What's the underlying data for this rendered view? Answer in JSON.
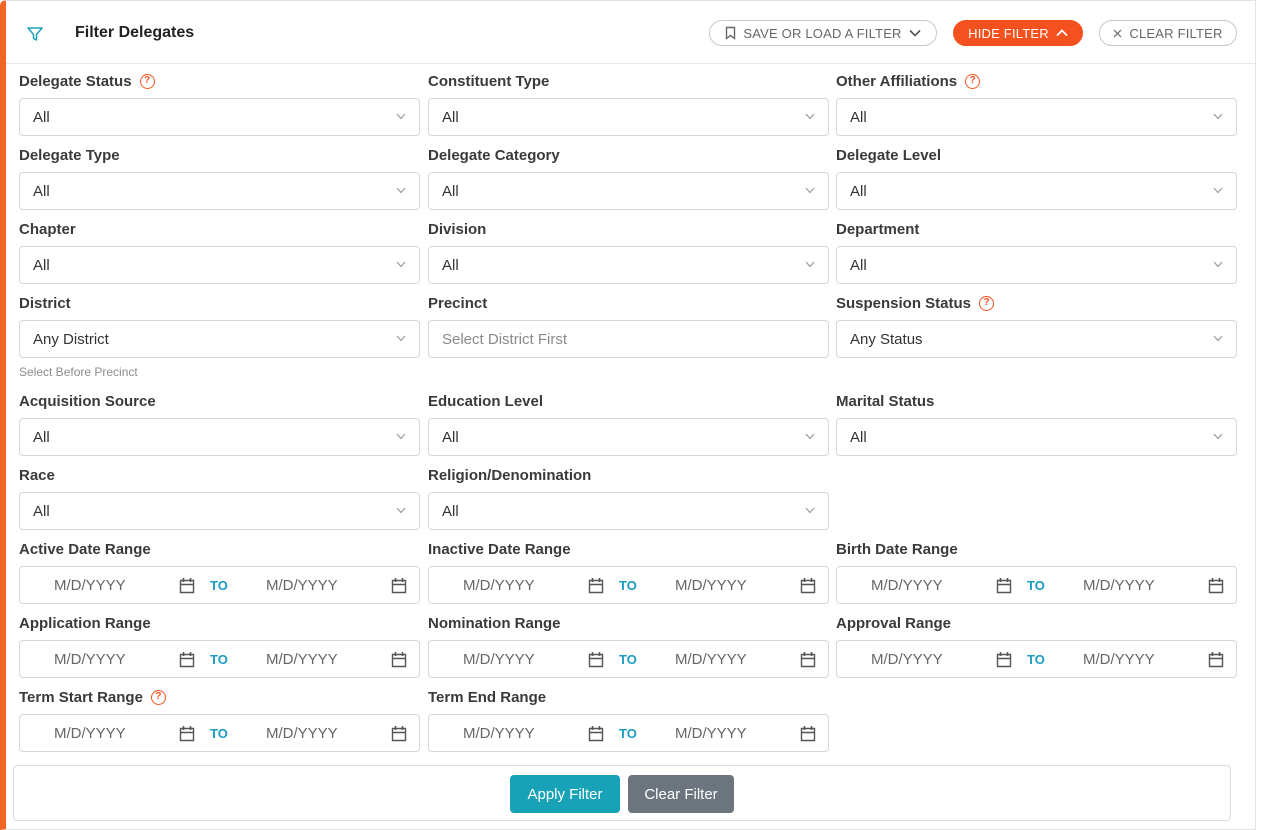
{
  "header": {
    "title": "Filter Delegates",
    "save_load_label": "SAVE OR LOAD A FILTER",
    "hide_filter_label": "HIDE FILTER",
    "clear_filter_label": "CLEAR FILTER"
  },
  "colors": {
    "accent": "#f4511e",
    "link": "#1a9bc4",
    "apply": "#17a2b8",
    "clear": "#6c757d"
  },
  "fields": {
    "delegate_status": {
      "label": "Delegate Status",
      "value": "All",
      "help": "?"
    },
    "constituent_type": {
      "label": "Constituent Type",
      "value": "All"
    },
    "other_affiliations": {
      "label": "Other Affiliations",
      "value": "All",
      "help": "?"
    },
    "delegate_type": {
      "label": "Delegate Type",
      "value": "All"
    },
    "delegate_category": {
      "label": "Delegate Category",
      "value": "All"
    },
    "delegate_level": {
      "label": "Delegate Level",
      "value": "All"
    },
    "chapter": {
      "label": "Chapter",
      "value": "All"
    },
    "division": {
      "label": "Division",
      "value": "All"
    },
    "department": {
      "label": "Department",
      "value": "All"
    },
    "district": {
      "label": "District",
      "value": "Any District",
      "hint": "Select Before Precinct"
    },
    "precinct": {
      "label": "Precinct",
      "placeholder": "Select District First"
    },
    "suspension_status": {
      "label": "Suspension Status",
      "value": "Any Status",
      "help": "?"
    },
    "acquisition_source": {
      "label": "Acquisition Source",
      "value": "All"
    },
    "education_level": {
      "label": "Education Level",
      "value": "All"
    },
    "marital_status": {
      "label": "Marital Status",
      "value": "All"
    },
    "race": {
      "label": "Race",
      "value": "All"
    },
    "religion": {
      "label": "Religion/Denomination",
      "value": "All"
    }
  },
  "date_ranges": {
    "placeholder": "M/D/YYYY",
    "to_label": "TO",
    "active": {
      "label": "Active Date Range"
    },
    "inactive": {
      "label": "Inactive Date Range"
    },
    "birth": {
      "label": "Birth Date Range"
    },
    "application": {
      "label": "Application Range"
    },
    "nomination": {
      "label": "Nomination Range"
    },
    "approval": {
      "label": "Approval Range"
    },
    "term_start": {
      "label": "Term Start Range",
      "help": "?"
    },
    "term_end": {
      "label": "Term End Range"
    }
  },
  "footer": {
    "apply_label": "Apply Filter",
    "clear_label": "Clear Filter"
  }
}
